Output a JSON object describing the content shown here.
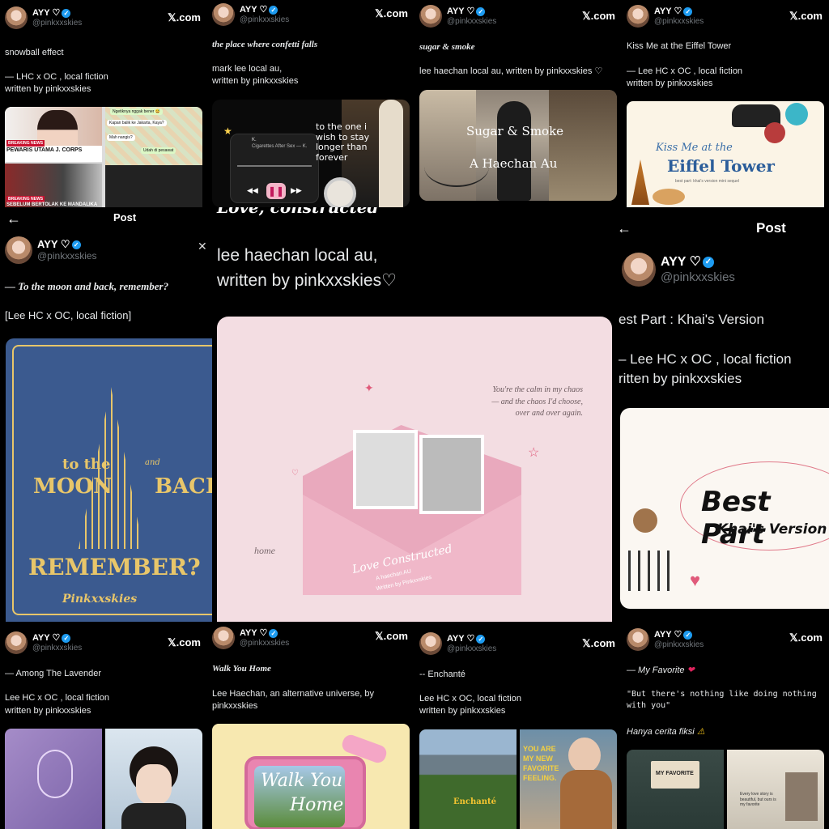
{
  "common": {
    "name": "AYY ♡",
    "handle": "@pinkxxskies",
    "x_label": "𝕏.com",
    "verified_icon": "✓"
  },
  "cards": {
    "c1": {
      "title": "snowball effect",
      "line1": "— LHC x OC , local fiction",
      "line2": "written by pinkxxskies",
      "news1": "BREAKING NEWS",
      "news2": "PEWARIS UTAMA J. CORPS",
      "news3": "BREAKING NEWS",
      "news4": "SEBELUM BERTOLAK KE MANDALIKA",
      "chat1": "Ngetiknya nggak bener 😅",
      "chat2": "Kapan balik ke Jakarta, Kaya?",
      "chat3": "Mah nangis?",
      "chat4": "Udah di pesawat"
    },
    "c2": {
      "title": "the place where confetti falls",
      "line1": "mark lee local au,",
      "line2": "written by pinkxxskies",
      "song1": "K.",
      "song2": "Cigarettes After Sex — K.",
      "quote": "to the one i wish to stay longer than forever"
    },
    "c3": {
      "title": "sugar & smoke",
      "line1": "lee haechan local au, written by pinkxxskies ♡",
      "cover1": "Sugar & Smoke",
      "cover2": "A Haechan Au"
    },
    "c4": {
      "title": "Kiss Me at the Eiffel Tower",
      "line1": "— Lee HC x OC , local fiction",
      "line2": "written by pinkxxskies",
      "cover1": "Kiss Me at the",
      "cover2": "Eiffel Tower",
      "cover3": "best part: khai's version mini sequel"
    },
    "c5": {
      "post": "Post",
      "title": "— To the moon and back, remember?",
      "line1": "[Lee HC x OC, local fiction]",
      "cover1": "to the",
      "cover2": "and",
      "cover3": "MOON",
      "cover4": "BACK",
      "cover5": "REMEMBER?",
      "cover6": "Pinkxxskies"
    },
    "c6": {
      "title": "Love, constructed",
      "line1": "lee haechan local au,",
      "line2": "written by pinkxxskies♡",
      "poem1": "You're the calm in my chaos",
      "poem2": "— and the chaos I'd choose,",
      "poem3": "over and over again.",
      "home": "home",
      "cover1": "Love Constructed",
      "cover2": "A haechan AU",
      "cover3": "Written by Pinkxxskies"
    },
    "c7": {
      "post": "Post",
      "title": "est Part : Khai's Version",
      "line1": "– Lee HC x OC , local fiction",
      "line2": "ritten by pinkxxskies",
      "cover1": "Best Part",
      "cover2": "Khai's Version"
    },
    "c8": {
      "title": "— Among The Lavender",
      "line1": "Lee HC x OC , local fiction",
      "line2": "written by pinkxxskies"
    },
    "c9": {
      "title": "Walk You Home",
      "line1": "Lee Haechan, an alternative universe, by",
      "line2": "pinkxxskies",
      "cover1": "Walk You",
      "cover2": "Home"
    },
    "c10": {
      "title": "-- Enchanté",
      "line1": "Lee HC x OC, local fiction",
      "line2": "written by pinkxxskies",
      "cover1": "Enchanté",
      "cover2": "YOU ARE",
      "cover3": "MY NEW",
      "cover4": "FAVORITE",
      "cover5": "FEELING."
    },
    "c11": {
      "title": "— My Favorite",
      "quote": "\"But there's nothing like doing nothing with you\"",
      "line1": "Hanya cerita fiksi",
      "cover1": "MY FAVORITE",
      "cover2": "Every love story is beautiful, but ours is my favorite"
    }
  },
  "colors": {
    "bg": "#000000",
    "text": "#e7e9ea",
    "muted": "#71767b",
    "verified": "#1d9bf0"
  }
}
